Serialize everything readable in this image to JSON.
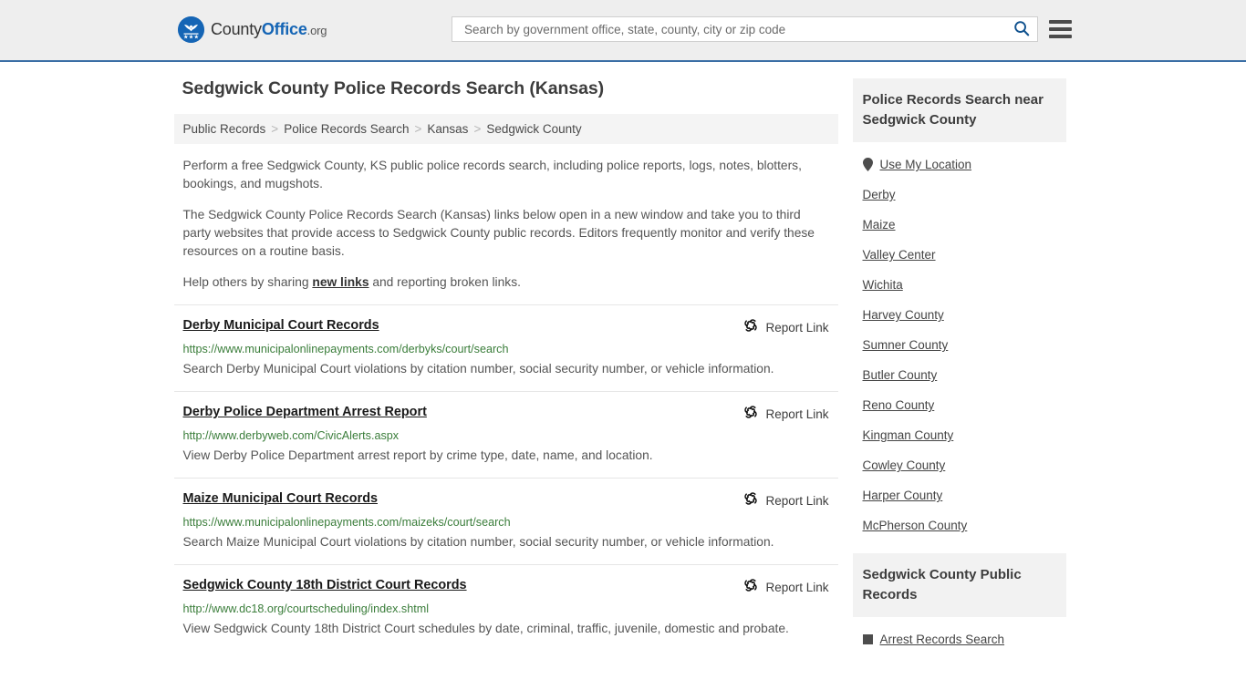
{
  "header": {
    "logo": {
      "part1": "County",
      "part2": "Office",
      "part3": ".org",
      "icon": "eagle-shield-logo-icon"
    },
    "search": {
      "placeholder": "Search by government office, state, county, city or zip code",
      "value": "",
      "icon": "search-icon"
    },
    "menu_icon": "hamburger-menu-icon"
  },
  "page": {
    "title": "Sedgwick County Police Records Search (Kansas)"
  },
  "breadcrumb": {
    "items": [
      {
        "label": "Public Records"
      },
      {
        "label": "Police Records Search"
      },
      {
        "label": "Kansas"
      },
      {
        "label": "Sedgwick County"
      }
    ],
    "separator": ">"
  },
  "intro": {
    "p1": "Perform a free Sedgwick County, KS public police records search, including police reports, logs, notes, blotters, bookings, and mugshots.",
    "p2": "The Sedgwick County Police Records Search (Kansas) links below open in a new window and take you to third party websites that provide access to Sedgwick County public records. Editors frequently monitor and verify these resources on a routine basis.",
    "p3_before": "Help others by sharing ",
    "p3_link": "new links",
    "p3_after": " and reporting broken links."
  },
  "report_link_label": "Report Link",
  "report_link_icon": "broken-link-icon",
  "results": [
    {
      "title": "Derby Municipal Court Records",
      "url": "https://www.municipalonlinepayments.com/derbyks/court/search",
      "description": "Search Derby Municipal Court violations by citation number, social security number, or vehicle information."
    },
    {
      "title": "Derby Police Department Arrest Report",
      "url": "http://www.derbyweb.com/CivicAlerts.aspx",
      "description": "View Derby Police Department arrest report by crime type, date, name, and location."
    },
    {
      "title": "Maize Municipal Court Records",
      "url": "https://www.municipalonlinepayments.com/maizeks/court/search",
      "description": "Search Maize Municipal Court violations by citation number, social security number, or vehicle information."
    },
    {
      "title": "Sedgwick County 18th District Court Records",
      "url": "http://www.dc18.org/courtscheduling/index.shtml",
      "description": "View Sedgwick County 18th District Court schedules by date, criminal, traffic, juvenile, domestic and probate."
    }
  ],
  "sidebar": {
    "nearby": {
      "title": "Police Records Search near Sedgwick County",
      "use_my_location": {
        "label": "Use My Location",
        "icon": "map-pin-icon"
      },
      "links": [
        {
          "label": "Derby"
        },
        {
          "label": "Maize"
        },
        {
          "label": "Valley Center"
        },
        {
          "label": "Wichita"
        },
        {
          "label": "Harvey County"
        },
        {
          "label": "Sumner County"
        },
        {
          "label": "Butler County"
        },
        {
          "label": "Reno County"
        },
        {
          "label": "Kingman County"
        },
        {
          "label": "Cowley County"
        },
        {
          "label": "Harper County"
        },
        {
          "label": "McPherson County"
        }
      ]
    },
    "public_records": {
      "title": "Sedgwick County Public Records",
      "links": [
        {
          "label": "Arrest Records Search"
        }
      ]
    }
  },
  "colors": {
    "brand_blue": "#1565b5",
    "header_bg": "#eeeeee",
    "header_border": "#3a6ea5",
    "url_green": "#3a7d3a",
    "panel_gray": "#f2f2f2"
  }
}
